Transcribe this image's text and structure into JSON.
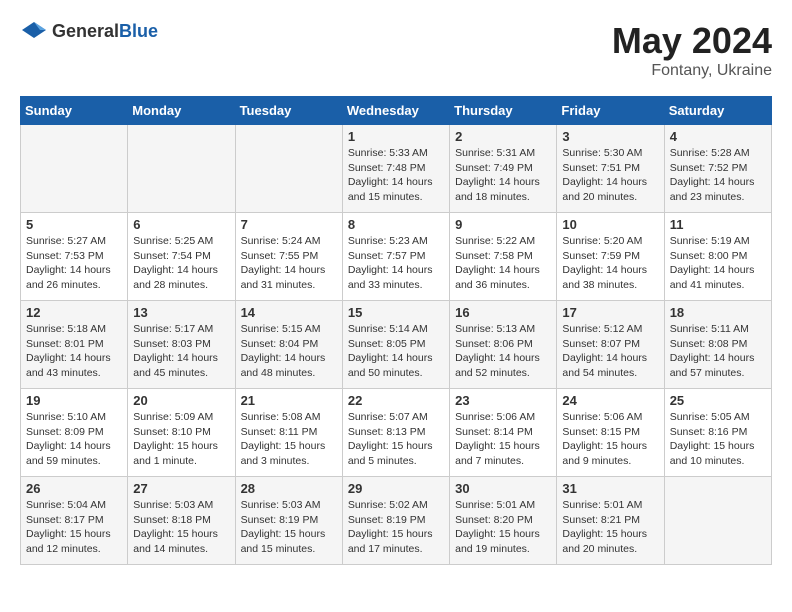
{
  "header": {
    "logo_general": "General",
    "logo_blue": "Blue",
    "title": "May 2024",
    "location": "Fontany, Ukraine"
  },
  "weekdays": [
    "Sunday",
    "Monday",
    "Tuesday",
    "Wednesday",
    "Thursday",
    "Friday",
    "Saturday"
  ],
  "weeks": [
    [
      {
        "day": "",
        "info": ""
      },
      {
        "day": "",
        "info": ""
      },
      {
        "day": "",
        "info": ""
      },
      {
        "day": "1",
        "info": "Sunrise: 5:33 AM\nSunset: 7:48 PM\nDaylight: 14 hours\nand 15 minutes."
      },
      {
        "day": "2",
        "info": "Sunrise: 5:31 AM\nSunset: 7:49 PM\nDaylight: 14 hours\nand 18 minutes."
      },
      {
        "day": "3",
        "info": "Sunrise: 5:30 AM\nSunset: 7:51 PM\nDaylight: 14 hours\nand 20 minutes."
      },
      {
        "day": "4",
        "info": "Sunrise: 5:28 AM\nSunset: 7:52 PM\nDaylight: 14 hours\nand 23 minutes."
      }
    ],
    [
      {
        "day": "5",
        "info": "Sunrise: 5:27 AM\nSunset: 7:53 PM\nDaylight: 14 hours\nand 26 minutes."
      },
      {
        "day": "6",
        "info": "Sunrise: 5:25 AM\nSunset: 7:54 PM\nDaylight: 14 hours\nand 28 minutes."
      },
      {
        "day": "7",
        "info": "Sunrise: 5:24 AM\nSunset: 7:55 PM\nDaylight: 14 hours\nand 31 minutes."
      },
      {
        "day": "8",
        "info": "Sunrise: 5:23 AM\nSunset: 7:57 PM\nDaylight: 14 hours\nand 33 minutes."
      },
      {
        "day": "9",
        "info": "Sunrise: 5:22 AM\nSunset: 7:58 PM\nDaylight: 14 hours\nand 36 minutes."
      },
      {
        "day": "10",
        "info": "Sunrise: 5:20 AM\nSunset: 7:59 PM\nDaylight: 14 hours\nand 38 minutes."
      },
      {
        "day": "11",
        "info": "Sunrise: 5:19 AM\nSunset: 8:00 PM\nDaylight: 14 hours\nand 41 minutes."
      }
    ],
    [
      {
        "day": "12",
        "info": "Sunrise: 5:18 AM\nSunset: 8:01 PM\nDaylight: 14 hours\nand 43 minutes."
      },
      {
        "day": "13",
        "info": "Sunrise: 5:17 AM\nSunset: 8:03 PM\nDaylight: 14 hours\nand 45 minutes."
      },
      {
        "day": "14",
        "info": "Sunrise: 5:15 AM\nSunset: 8:04 PM\nDaylight: 14 hours\nand 48 minutes."
      },
      {
        "day": "15",
        "info": "Sunrise: 5:14 AM\nSunset: 8:05 PM\nDaylight: 14 hours\nand 50 minutes."
      },
      {
        "day": "16",
        "info": "Sunrise: 5:13 AM\nSunset: 8:06 PM\nDaylight: 14 hours\nand 52 minutes."
      },
      {
        "day": "17",
        "info": "Sunrise: 5:12 AM\nSunset: 8:07 PM\nDaylight: 14 hours\nand 54 minutes."
      },
      {
        "day": "18",
        "info": "Sunrise: 5:11 AM\nSunset: 8:08 PM\nDaylight: 14 hours\nand 57 minutes."
      }
    ],
    [
      {
        "day": "19",
        "info": "Sunrise: 5:10 AM\nSunset: 8:09 PM\nDaylight: 14 hours\nand 59 minutes."
      },
      {
        "day": "20",
        "info": "Sunrise: 5:09 AM\nSunset: 8:10 PM\nDaylight: 15 hours\nand 1 minute."
      },
      {
        "day": "21",
        "info": "Sunrise: 5:08 AM\nSunset: 8:11 PM\nDaylight: 15 hours\nand 3 minutes."
      },
      {
        "day": "22",
        "info": "Sunrise: 5:07 AM\nSunset: 8:13 PM\nDaylight: 15 hours\nand 5 minutes."
      },
      {
        "day": "23",
        "info": "Sunrise: 5:06 AM\nSunset: 8:14 PM\nDaylight: 15 hours\nand 7 minutes."
      },
      {
        "day": "24",
        "info": "Sunrise: 5:06 AM\nSunset: 8:15 PM\nDaylight: 15 hours\nand 9 minutes."
      },
      {
        "day": "25",
        "info": "Sunrise: 5:05 AM\nSunset: 8:16 PM\nDaylight: 15 hours\nand 10 minutes."
      }
    ],
    [
      {
        "day": "26",
        "info": "Sunrise: 5:04 AM\nSunset: 8:17 PM\nDaylight: 15 hours\nand 12 minutes."
      },
      {
        "day": "27",
        "info": "Sunrise: 5:03 AM\nSunset: 8:18 PM\nDaylight: 15 hours\nand 14 minutes."
      },
      {
        "day": "28",
        "info": "Sunrise: 5:03 AM\nSunset: 8:19 PM\nDaylight: 15 hours\nand 15 minutes."
      },
      {
        "day": "29",
        "info": "Sunrise: 5:02 AM\nSunset: 8:19 PM\nDaylight: 15 hours\nand 17 minutes."
      },
      {
        "day": "30",
        "info": "Sunrise: 5:01 AM\nSunset: 8:20 PM\nDaylight: 15 hours\nand 19 minutes."
      },
      {
        "day": "31",
        "info": "Sunrise: 5:01 AM\nSunset: 8:21 PM\nDaylight: 15 hours\nand 20 minutes."
      },
      {
        "day": "",
        "info": ""
      }
    ]
  ]
}
